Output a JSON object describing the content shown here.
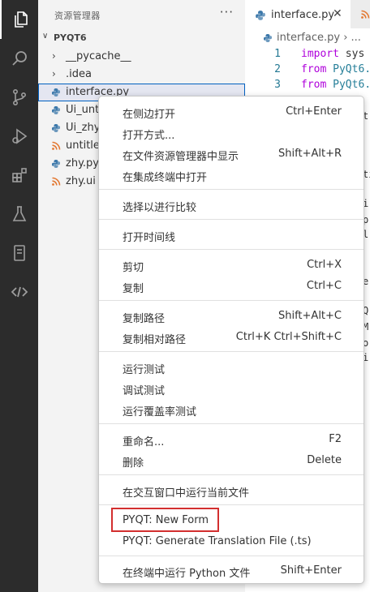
{
  "activity_bar": {
    "items": [
      {
        "icon": "files-icon",
        "active": true
      },
      {
        "icon": "search-icon",
        "active": false
      },
      {
        "icon": "source-control-icon",
        "active": false
      },
      {
        "icon": "run-debug-icon",
        "active": false
      },
      {
        "icon": "extensions-icon",
        "active": false
      },
      {
        "icon": "testing-icon",
        "active": false
      },
      {
        "icon": "notebook-icon",
        "active": false
      },
      {
        "icon": "remote-icon",
        "active": false
      }
    ]
  },
  "sidebar": {
    "title": "资源管理器",
    "more": "···",
    "folder": {
      "chevron": "∨",
      "name": "PYQT6"
    },
    "items": [
      {
        "label": "__pycache__",
        "chevron": "›"
      },
      {
        "label": ".idea",
        "chevron": "›"
      },
      {
        "label": "interface.py",
        "icon": "python-file-icon",
        "selected": true
      },
      {
        "label": "Ui_untitled.py",
        "icon": "python-file-icon"
      },
      {
        "label": "Ui_zhy.py",
        "icon": "python-file-icon"
      },
      {
        "label": "untitled.ui",
        "icon": "rss-file-icon"
      },
      {
        "label": "zhy.py",
        "icon": "python-file-icon"
      },
      {
        "label": "zhy.ui",
        "icon": "rss-file-icon"
      }
    ]
  },
  "editor": {
    "tab_label": "interface.py",
    "tab_close": "✕",
    "breadcrumb": "interface.py › ...",
    "lines": [
      {
        "num": "1",
        "kw": "import",
        "rest": " sys"
      },
      {
        "num": "2",
        "kw": "from",
        "rest": " PyQt6."
      },
      {
        "num": "3",
        "kw": "from",
        "rest": " PyQt6."
      }
    ],
    "fragments": [
      "t",
      "ti",
      "i",
      "p",
      "l",
      "e",
      "Q",
      "M",
      "o",
      "i"
    ]
  },
  "context_menu": {
    "groups": [
      [
        {
          "label": "在侧边打开",
          "shortcut": "Ctrl+Enter"
        },
        {
          "label": "打开方式...",
          "shortcut": ""
        },
        {
          "label": "在文件资源管理器中显示",
          "shortcut": "Shift+Alt+R"
        },
        {
          "label": "在集成终端中打开",
          "shortcut": ""
        }
      ],
      [
        {
          "label": "选择以进行比较",
          "shortcut": ""
        }
      ],
      [
        {
          "label": "打开时间线",
          "shortcut": ""
        }
      ],
      [
        {
          "label": "剪切",
          "shortcut": "Ctrl+X"
        },
        {
          "label": "复制",
          "shortcut": "Ctrl+C"
        }
      ],
      [
        {
          "label": "复制路径",
          "shortcut": "Shift+Alt+C"
        },
        {
          "label": "复制相对路径",
          "shortcut": "Ctrl+K Ctrl+Shift+C"
        }
      ],
      [
        {
          "label": "运行测试",
          "shortcut": ""
        },
        {
          "label": "调试测试",
          "shortcut": ""
        },
        {
          "label": "运行覆盖率测试",
          "shortcut": ""
        }
      ],
      [
        {
          "label": "重命名...",
          "shortcut": "F2"
        },
        {
          "label": "删除",
          "shortcut": "Delete"
        }
      ],
      [
        {
          "label": "在交互窗口中运行当前文件",
          "shortcut": ""
        }
      ],
      [
        {
          "label": "PYQT: New Form",
          "shortcut": "",
          "highlighted": true
        },
        {
          "label": "PYQT: Generate Translation File (.ts)",
          "shortcut": ""
        }
      ],
      [
        {
          "label": "在终端中运行 Python 文件",
          "shortcut": "Shift+Enter"
        }
      ]
    ]
  },
  "colors": {
    "activity_bar": "#2c2c2c",
    "sidebar": "#f3f3f3",
    "selection_border": "#0060c0",
    "highlight_box": "#d32f2f",
    "python_icon": "#3c78aa",
    "rss_icon": "#e37933"
  }
}
